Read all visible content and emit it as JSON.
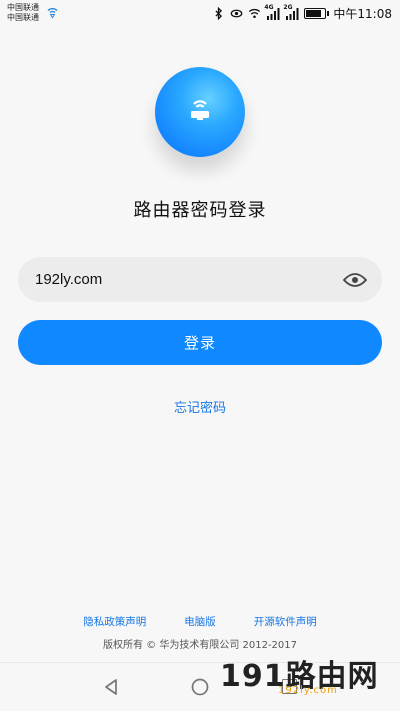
{
  "status_bar": {
    "carrier_line1": "中国联通",
    "carrier_line2": "中国联通",
    "network_tag_1": "4G",
    "network_tag_2": "2G",
    "time": "中午11:08"
  },
  "login": {
    "title": "路由器密码登录",
    "password_value": "192ly.com",
    "login_button_label": "登录",
    "forgot_password": "忘记密码"
  },
  "footer": {
    "links": [
      "隐私政策声明",
      "电脑版",
      "开源软件声明"
    ],
    "copyright": "版权所有 © 华为技术有限公司 2012-2017"
  },
  "watermark": {
    "text": "191路由网",
    "subtext": "192ly.com"
  },
  "colors": {
    "accent": "#1088ff",
    "link": "#1677e5",
    "input_bg": "#ececec",
    "background": "#f7f7f7"
  },
  "icons": {
    "router": "router-icon",
    "eye": "eye-icon",
    "back": "back-icon",
    "home": "home-icon",
    "recent": "recent-apps-icon"
  }
}
